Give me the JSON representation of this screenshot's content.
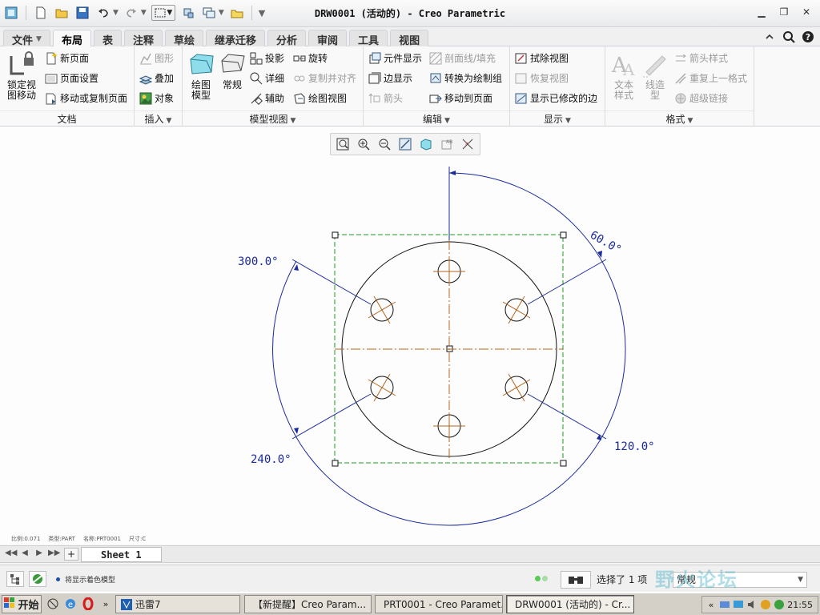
{
  "window": {
    "title": "DRW0001 (活动的) - Creo Parametric"
  },
  "qat": {
    "icons": [
      "app-icon",
      "new-icon",
      "open-icon",
      "save-icon",
      "undo-icon",
      "redo-icon",
      "select-box-icon",
      "regenerate-icon",
      "windows-icon",
      "folder-icon",
      "customize-icon"
    ]
  },
  "tabs": [
    {
      "label": "文件",
      "has_dropdown": true
    },
    {
      "label": "布局",
      "active": true
    },
    {
      "label": "表"
    },
    {
      "label": "注释"
    },
    {
      "label": "草绘"
    },
    {
      "label": "继承迁移"
    },
    {
      "label": "分析"
    },
    {
      "label": "审阅"
    },
    {
      "label": "工具"
    },
    {
      "label": "视图"
    }
  ],
  "ribbon": {
    "doc": {
      "label": "文档",
      "lock_view": "锁定视图移动",
      "lock_view_l1": "锁定视",
      "lock_view_l2": "图移动",
      "new_page": "新页面",
      "page_setup": "页面设置",
      "move_copy_page": "移动或复制页面"
    },
    "insert": {
      "label": "插入",
      "graph": "图形",
      "overlay": "叠加",
      "object": "对象"
    },
    "model_views": {
      "label": "模型视图",
      "drawing_model_l1": "绘图",
      "drawing_model_l2": "模型",
      "general": "常规",
      "projection": "投影",
      "rotate": "旋转",
      "detail": "详细",
      "copy_align": "复制并对齐",
      "auxiliary": "辅助",
      "drawing_view": "绘图视图"
    },
    "edit": {
      "label": "编辑",
      "component_display": "元件显示",
      "xhatch": "剖面线/填充",
      "edge_display": "边显示",
      "convert_group": "转换为绘制组",
      "arrow": "箭头",
      "move_to_page": "移动到页面"
    },
    "display": {
      "label": "显示",
      "erase_view": "拭除视图",
      "resume_view": "恢复视图",
      "show_modified_edges": "显示已修改的边"
    },
    "format": {
      "label": "格式",
      "text_style_l1": "文本",
      "text_style_l2": "样式",
      "line_style_l1": "线造",
      "line_style_l2": "型",
      "arrow_style": "箭头样式",
      "repeat_format": "重复上一格式",
      "hyperlink": "超级链接"
    }
  },
  "view_toolbar": {
    "icons": [
      "refit-icon",
      "zoom-in-icon",
      "zoom-out-icon",
      "repaint-icon",
      "display-style-icon",
      "annotation-display-icon",
      "datum-display-icon"
    ]
  },
  "drawing": {
    "dimensions": {
      "d300": "300.0°",
      "d60": "60.0°",
      "d240": "240.0°",
      "d120": "120.0°"
    },
    "colors": {
      "outline": "#111111",
      "centerline": "#b5651d",
      "dimension": "#1a2a9a",
      "selection_box": "#1a9a1a"
    }
  },
  "scale_info": {
    "scale": "比例:0.071",
    "type": "类型:PART",
    "name": "名称:PRT0001",
    "size": "尺寸:C"
  },
  "sheet": {
    "name": "Sheet 1",
    "add": "+"
  },
  "status": {
    "message": "将显示着色模型",
    "selected": "选择了 1 项",
    "filter": "常规"
  },
  "watermark": "野火论坛",
  "taskbar": {
    "start": "开始",
    "items": [
      {
        "label": "迅雷7"
      },
      {
        "label": "【新提醒】Creo Param..."
      },
      {
        "label": "PRT0001 - Creo Paramet..."
      },
      {
        "label": "DRW0001 (活动的) - Cr...",
        "active": true
      }
    ],
    "clock": "21:55"
  }
}
